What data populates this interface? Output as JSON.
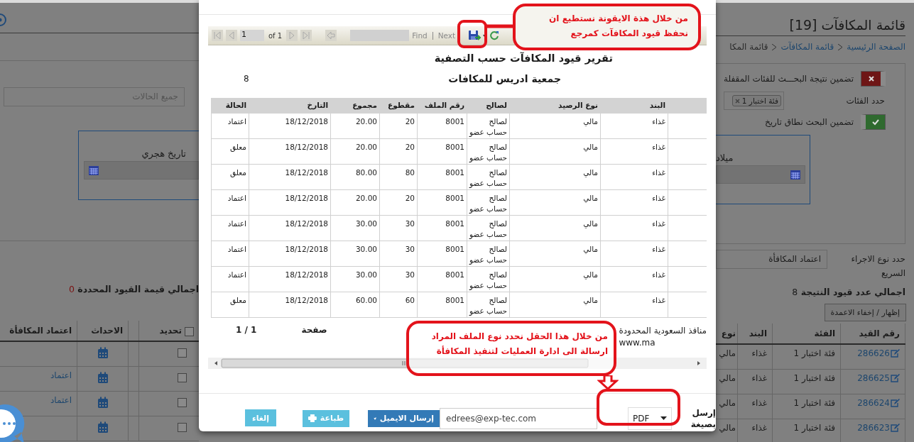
{
  "page": {
    "title": "قائمة المكافآت [19]",
    "breadcrumb": [
      {
        "label": "الصفحة الرئيسية",
        "link": true
      },
      {
        "label": "قائمة المكافآت",
        "link": true
      },
      {
        "label": "قائمة المكا",
        "link": false
      }
    ],
    "filters": {
      "locked_toggle": {
        "label": "تضمين نتيجة البحـــث للفئات المقفلة",
        "on": false
      },
      "categories_label": "حدد الفئات",
      "category_tags": [
        "فئة اختبار 1"
      ],
      "status_field": {
        "placeholder": "جميع الحالات"
      },
      "date_toggle": {
        "label": "تضمين البحث نطاق تاريخ",
        "on": true
      },
      "gregorian_label": "ميلاد",
      "hijri_label": "تاريخ هجري"
    },
    "quick_action": {
      "label": "حدد نوع الاجراء السريع",
      "value": "اعتماد المكافأة"
    },
    "result_count": {
      "label": "اجمالي عدد قيود النتيجة",
      "value": "8"
    },
    "selected_total": {
      "label": "اجمالي قيمة القيود المحددة",
      "value": "0"
    },
    "columns_button": "إظهار / إخفاء الاعمدة",
    "table": {
      "columns_right": [
        "رقم القيد",
        "الفئة",
        "البند",
        "نوع"
      ],
      "columns_left": [
        "تحديد",
        "الاحداث",
        "اعتماد المكافأة"
      ],
      "select_all_checked": false,
      "rows": [
        {
          "id": "286626",
          "category": "فئة اختبار 1",
          "item": "غذاء",
          "type": "مالي",
          "checked": false
        },
        {
          "id": "286625",
          "category": "فئة اختبار 1",
          "item": "غذاء",
          "type": "مالي",
          "checked": false,
          "approve": "اعتماد"
        },
        {
          "id": "286624",
          "category": "فئة اختبار 1",
          "item": "غذاء",
          "type": "مالي",
          "checked": false,
          "approve": "اعتماد"
        },
        {
          "id": "286623",
          "category": "فئة اختبار 1",
          "item": "غذاء",
          "type": "مالي",
          "checked": false
        }
      ]
    }
  },
  "modal": {
    "toolbar": {
      "page": "1",
      "of": "of 1",
      "find": "Find",
      "next": "Next"
    },
    "report": {
      "title": "تقرير قيود المكافآت حسب التصفية",
      "subtitle": "جمعية ادريس للمكافات",
      "count": "8",
      "columns": [
        "البند",
        "نوع الرصيد",
        "لصالح",
        "رقم الملف",
        "مقطوع",
        "مجموع",
        "التارخ",
        "الحالة"
      ],
      "rows": [
        [
          "غذاء",
          "مالي",
          "لصالح\nحساب عضو",
          "8001",
          "20",
          "20.00",
          "18/12/2018",
          "اعتماد"
        ],
        [
          "غذاء",
          "مالي",
          "لصالح\nحساب عضو",
          "8001",
          "20",
          "20.00",
          "18/12/2018",
          "معلق"
        ],
        [
          "غذاء",
          "مالي",
          "لصالح\nحساب عضو",
          "8001",
          "80",
          "80.00",
          "18/12/2018",
          "معلق"
        ],
        [
          "غذاء",
          "مالي",
          "لصالح\nحساب عضو",
          "8001",
          "20",
          "20.00",
          "18/12/2018",
          "اعتماد"
        ],
        [
          "غذاء",
          "مالي",
          "لصالح\nحساب عضو",
          "8001",
          "30",
          "30.00",
          "18/12/2018",
          "اعتماد"
        ],
        [
          "غذاء",
          "مالي",
          "لصالح\nحساب عضو",
          "8001",
          "30",
          "30.00",
          "18/12/2018",
          "اعتماد"
        ],
        [
          "غذاء",
          "مالي",
          "لصالح\nحساب عضو",
          "8001",
          "30",
          "30.00",
          "18/12/2018",
          "اعتماد"
        ],
        [
          "غذاء",
          "مالي",
          "لصالح\nحساب عضو",
          "8001",
          "60",
          "60.00",
          "18/12/2018",
          "معلق"
        ]
      ],
      "footer": {
        "company": "منافذ السعودية المحدودة",
        "website": "www.ma",
        "page_label": "صفحة",
        "page_value": "1 / 1"
      }
    },
    "send": {
      "label": "إرسل بصيغة",
      "format": "PDF",
      "email": "edrees@exp-tec.com",
      "email_button": "إرسال الايميل",
      "print_button": "طباعة",
      "cancel_button": "إلغاء"
    }
  },
  "annotations": [
    {
      "kind": "toolbar",
      "text": "من خلال هذة الايقونة نستطيع ان\nنحفظ قيود المكافآت كمرجع"
    },
    {
      "kind": "format",
      "text": "من خلال هذا الحقل نحدد نوع الملف المراد\nارسالة الى ادارة العمليات لتنفيذ المكافأة"
    }
  ]
}
